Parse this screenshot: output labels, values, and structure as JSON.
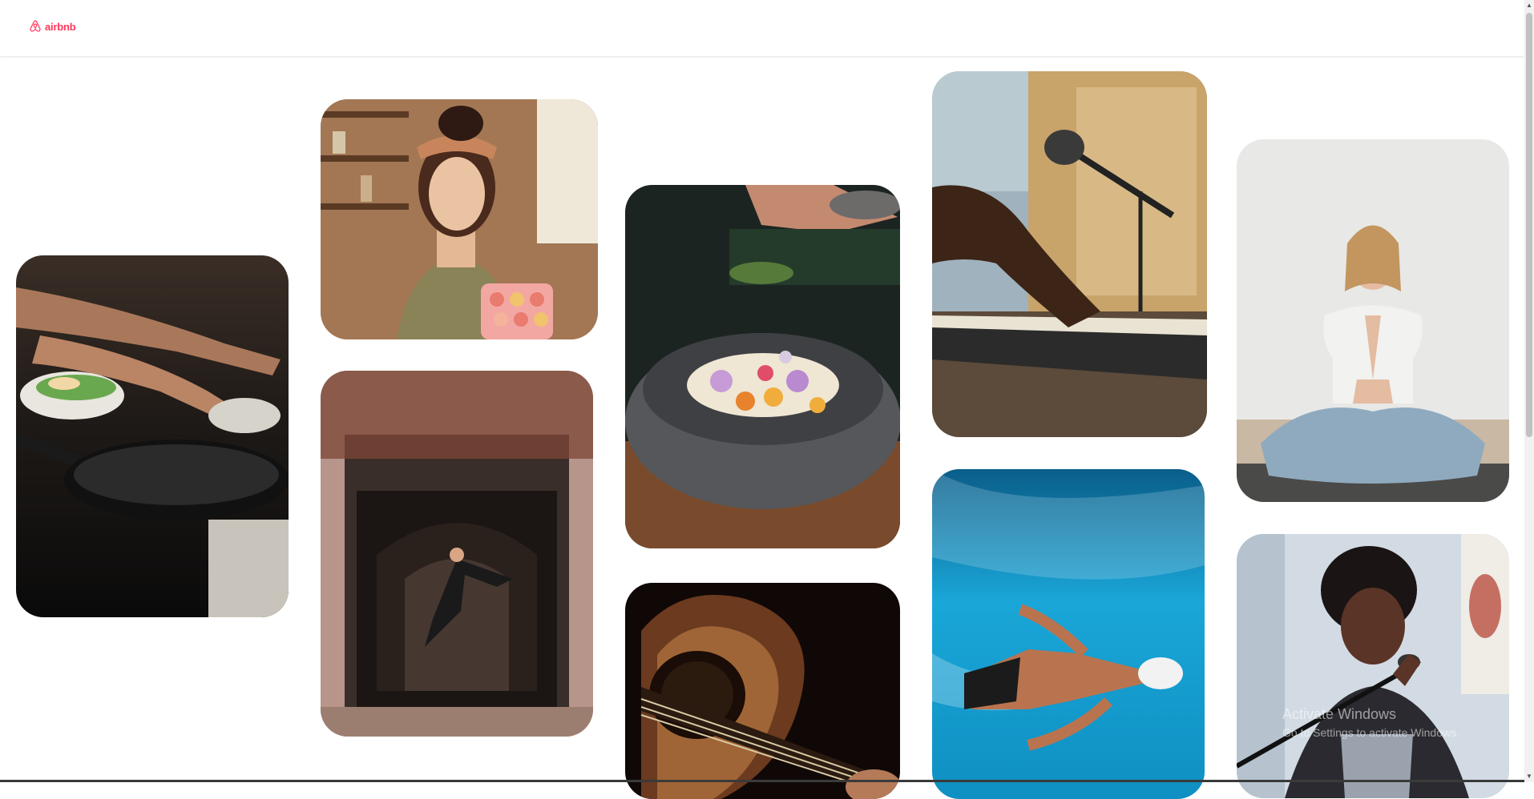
{
  "header": {
    "logo_text": "airbnb",
    "logo_icon": "airbnb-logo-icon",
    "brand_color": "#ff385c"
  },
  "gallery": {
    "tiles": [
      {
        "name": "cooking-class",
        "subject": "hands cooking with pan"
      },
      {
        "name": "baker",
        "subject": "woman holding macarons"
      },
      {
        "name": "dancer",
        "subject": "dancer leaping in archway"
      },
      {
        "name": "food-bowl",
        "subject": "salt sprinkled onto vegetable bowl"
      },
      {
        "name": "guitar",
        "subject": "acoustic guitar"
      },
      {
        "name": "pianist",
        "subject": "keyboard with microphone"
      },
      {
        "name": "swimmer",
        "subject": "swimmer in pool"
      },
      {
        "name": "yoga",
        "subject": "woman meditating"
      },
      {
        "name": "singer",
        "subject": "singer with microphone"
      }
    ]
  },
  "watermark": {
    "title": "Activate Windows",
    "subtitle": "Go to Settings to activate Windows."
  }
}
